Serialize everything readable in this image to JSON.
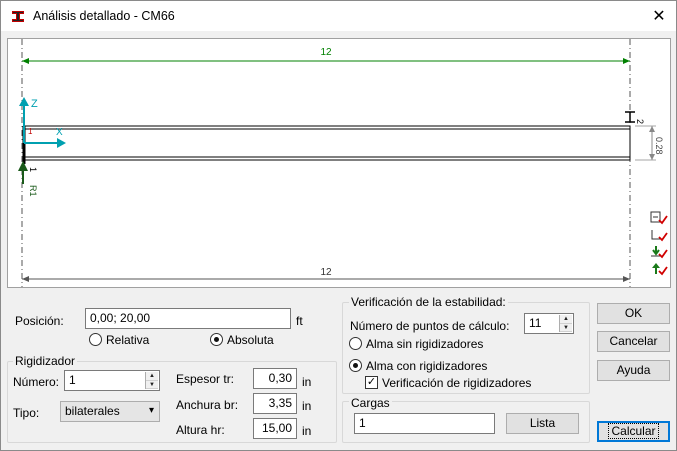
{
  "window": {
    "title": "Análisis detallado - CM66",
    "close_label": "✕"
  },
  "canvas": {
    "top_dim": "12",
    "bottom_dim": "12",
    "right_dim": "0.28",
    "z_axis": "Z",
    "x_axis": "X",
    "node_start": "1",
    "node_end": "2",
    "support_label": "R1",
    "mark_1": "1"
  },
  "posicion": {
    "label": "Posición:",
    "value": "0,00; 20,00",
    "unit": "ft",
    "opt_relativa": "Relativa",
    "opt_absoluta": "Absoluta"
  },
  "rigidizador": {
    "title": "Rigidizador",
    "numero_label": "Número:",
    "numero_value": "1",
    "tipo_label": "Tipo:",
    "tipo_value": "bilaterales",
    "espesor_label": "Espesor tr:",
    "espesor_value": "0,30",
    "espesor_unit": "in",
    "anchura_label": "Anchura br:",
    "anchura_value": "3,35",
    "anchura_unit": "in",
    "altura_label": "Altura hr:",
    "altura_value": "15,00",
    "altura_unit": "in"
  },
  "estabilidad": {
    "title": "Verificación de la estabilidad:",
    "puntos_label": "Número de puntos de cálculo:",
    "puntos_value": "11",
    "opt_sin": "Alma sin rigidizadores",
    "opt_con": "Alma con rigidizadores",
    "check_verif": "Verificación de rigidizadores"
  },
  "cargas": {
    "title": "Cargas",
    "value": "1",
    "lista_label": "Lista"
  },
  "buttons": {
    "ok": "OK",
    "cancelar": "Cancelar",
    "ayuda": "Ayuda",
    "calcular": "Calcular"
  },
  "colors": {
    "accent": "#0078d7",
    "dim_green": "#008000",
    "axis_cyan": "#00a0b0",
    "check_red": "#d00000"
  }
}
